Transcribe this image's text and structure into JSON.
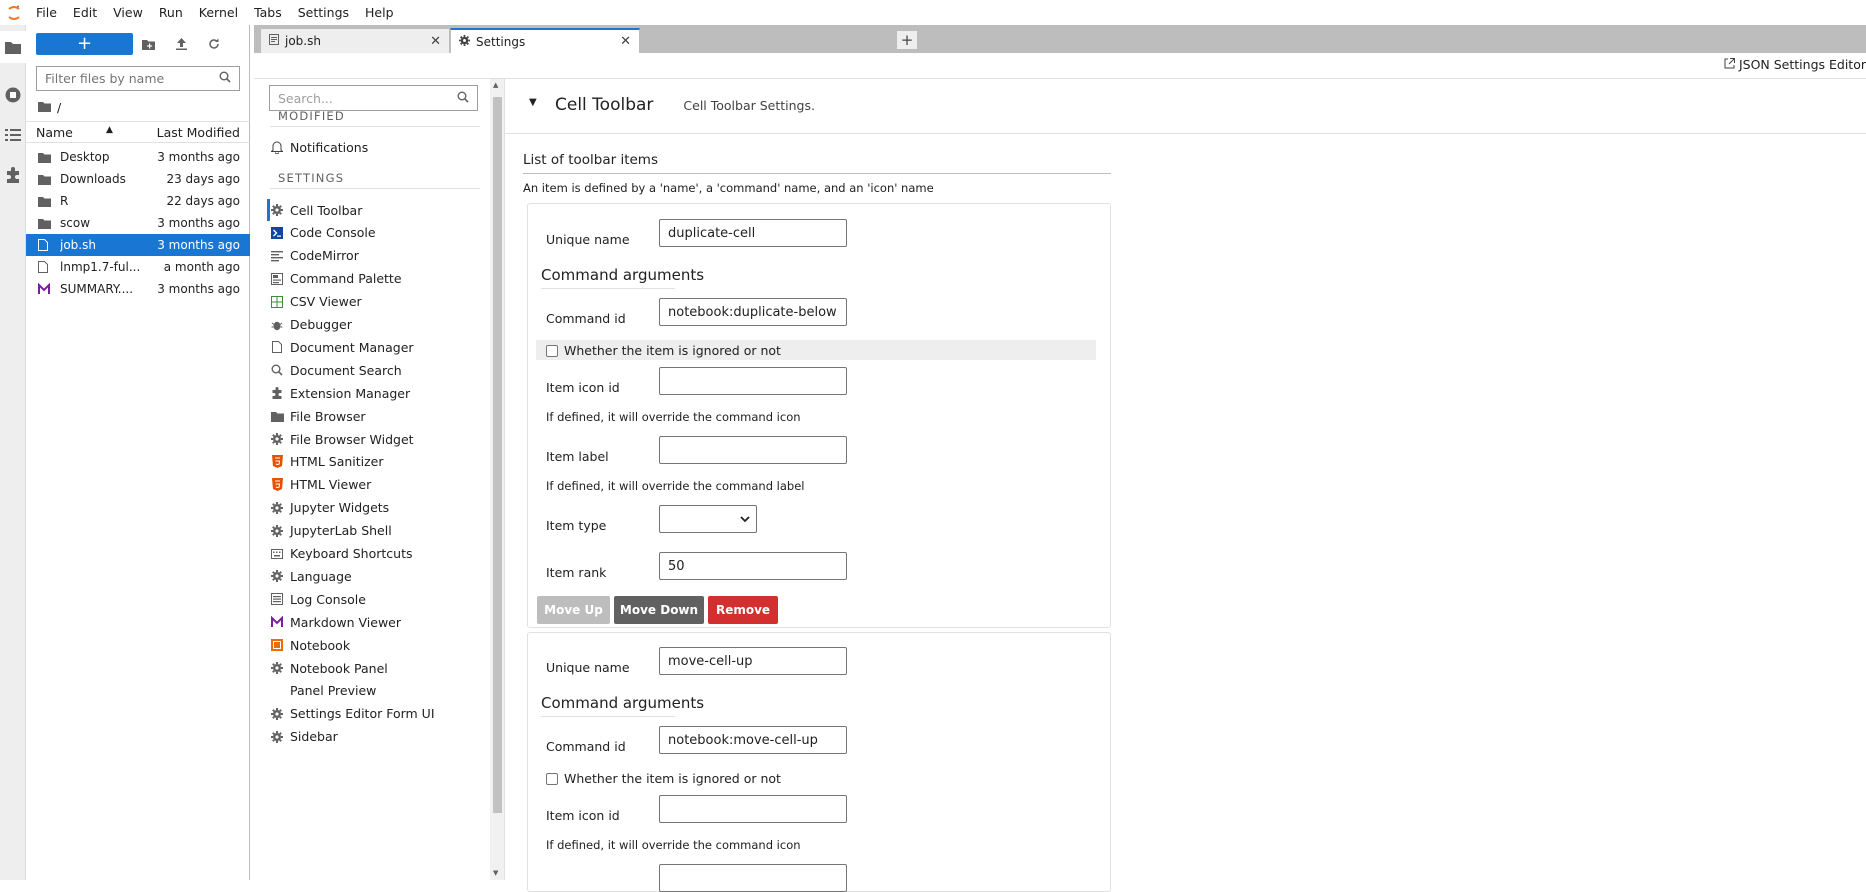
{
  "menubar": {
    "items": [
      "File",
      "Edit",
      "View",
      "Run",
      "Kernel",
      "Tabs",
      "Settings",
      "Help"
    ]
  },
  "activity_bar": {
    "icons": [
      "folder-icon",
      "running-icon",
      "toc-icon",
      "extension-icon"
    ]
  },
  "file_browser": {
    "new_label": "+",
    "filter_placeholder": "Filter files by name",
    "breadcrumb": "/",
    "columns": {
      "name": "Name",
      "modified": "Last Modified"
    },
    "files": [
      {
        "name": "Desktop",
        "modified": "3 months ago",
        "type": "folder"
      },
      {
        "name": "Downloads",
        "modified": "23 days ago",
        "type": "folder"
      },
      {
        "name": "R",
        "modified": "22 days ago",
        "type": "folder"
      },
      {
        "name": "scow",
        "modified": "3 months ago",
        "type": "folder"
      },
      {
        "name": "job.sh",
        "modified": "3 months ago",
        "type": "file",
        "selected": true
      },
      {
        "name": "lnmp1.7-ful...",
        "modified": "a month ago",
        "type": "file"
      },
      {
        "name": "SUMMARY....",
        "modified": "3 months ago",
        "type": "markdown"
      }
    ]
  },
  "tabs": [
    {
      "label": "job.sh",
      "icon": "text-file-icon",
      "active": false
    },
    {
      "label": "Settings",
      "icon": "gear-icon",
      "active": true
    }
  ],
  "settings_topbar": {
    "json_link": "JSON Settings Editor"
  },
  "settings_list": {
    "search_placeholder": "Search...",
    "modified_header": "MODIFIED",
    "modified_items": [
      {
        "label": "Notifications",
        "icon": "bell-icon"
      }
    ],
    "settings_header": "SETTINGS",
    "items": [
      {
        "label": "Cell Toolbar",
        "icon": "gear-icon",
        "active": true
      },
      {
        "label": "Code Console",
        "icon": "console-icon"
      },
      {
        "label": "CodeMirror",
        "icon": "text-editor-icon"
      },
      {
        "label": "Command Palette",
        "icon": "palette-icon"
      },
      {
        "label": "CSV Viewer",
        "icon": "spreadsheet-icon"
      },
      {
        "label": "Debugger",
        "icon": "bug-icon"
      },
      {
        "label": "Document Manager",
        "icon": "file-icon"
      },
      {
        "label": "Document Search",
        "icon": "search-icon"
      },
      {
        "label": "Extension Manager",
        "icon": "extension-icon"
      },
      {
        "label": "File Browser",
        "icon": "folder-icon"
      },
      {
        "label": "File Browser Widget",
        "icon": "gear-icon"
      },
      {
        "label": "HTML Sanitizer",
        "icon": "html5-icon"
      },
      {
        "label": "HTML Viewer",
        "icon": "html5-icon"
      },
      {
        "label": "Jupyter Widgets",
        "icon": "gear-icon"
      },
      {
        "label": "JupyterLab Shell",
        "icon": "gear-icon"
      },
      {
        "label": "Keyboard Shortcuts",
        "icon": "keyboard-icon"
      },
      {
        "label": "Language",
        "icon": "gear-icon"
      },
      {
        "label": "Log Console",
        "icon": "list-icon"
      },
      {
        "label": "Markdown Viewer",
        "icon": "markdown-icon"
      },
      {
        "label": "Notebook",
        "icon": "notebook-icon"
      },
      {
        "label": "Notebook Panel",
        "icon": "gear-icon"
      },
      {
        "label": "Panel Preview",
        "icon": ""
      },
      {
        "label": "Settings Editor Form UI",
        "icon": "gear-icon"
      },
      {
        "label": "Sidebar",
        "icon": "gear-icon"
      }
    ]
  },
  "editor": {
    "category_title": "Cell Toolbar",
    "category_desc": "Cell Toolbar Settings.",
    "section_title": "List of toolbar items",
    "section_desc": "An item is defined by a 'name', a 'command' name, and an 'icon' name",
    "labels": {
      "unique_name": "Unique name",
      "command_arguments": "Command arguments",
      "command_id": "Command id",
      "ignored": "Whether the item is ignored or not",
      "icon_id": "Item icon id",
      "icon_help": "If defined, it will override the command icon",
      "item_label": "Item label",
      "label_help": "If defined, it will override the command label",
      "item_type": "Item type",
      "item_rank": "Item rank"
    },
    "items": [
      {
        "unique_name": "duplicate-cell",
        "command_id": "notebook:duplicate-below",
        "icon_id": "",
        "label": "",
        "type": "",
        "rank": "50"
      },
      {
        "unique_name": "move-cell-up",
        "command_id": "notebook:move-cell-up",
        "icon_id": ""
      }
    ],
    "buttons": {
      "move_up": "Move Up",
      "move_down": "Move Down",
      "remove": "Remove"
    },
    "colors": {
      "move_up": "#bdbdbd",
      "move_down": "#616161",
      "remove": "#d32f2f",
      "accent": "#1976d2"
    }
  }
}
